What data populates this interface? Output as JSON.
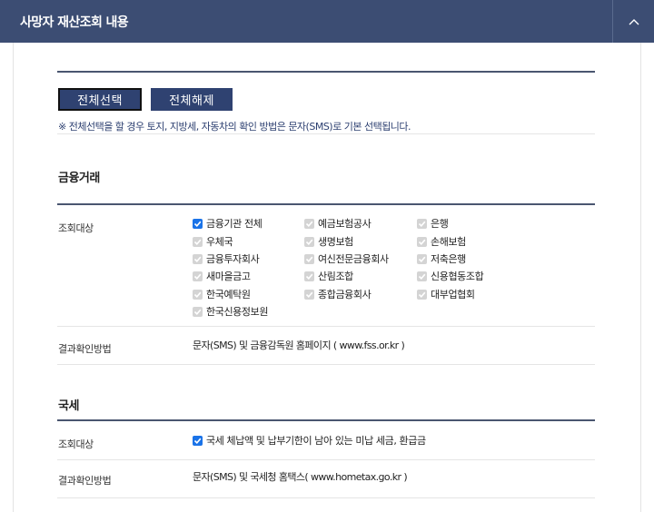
{
  "header": {
    "title": "사망자 재산조회 내용",
    "toggle_icon": "chevron-up-icon"
  },
  "buttons": {
    "select_all": "전체선택",
    "deselect_all": "전체해제"
  },
  "notice": "※ 전체선택을 할 경우 토지, 지방세, 자동차의 확인 방법은 문자(SMS)로 기본 선택됩니다.",
  "finance": {
    "title": "금융거래",
    "target_label": "조회대상",
    "items": [
      {
        "label": "금융기관 전체",
        "checked": true,
        "disabled": false
      },
      {
        "label": "예금보험공사",
        "checked": true,
        "disabled": true
      },
      {
        "label": "은행",
        "checked": true,
        "disabled": true
      },
      {
        "label": "우체국",
        "checked": true,
        "disabled": true
      },
      {
        "label": "생명보험",
        "checked": true,
        "disabled": true
      },
      {
        "label": "손해보험",
        "checked": true,
        "disabled": true
      },
      {
        "label": "금융투자회사",
        "checked": true,
        "disabled": true
      },
      {
        "label": "여신전문금융회사",
        "checked": true,
        "disabled": true
      },
      {
        "label": "저축은행",
        "checked": true,
        "disabled": true
      },
      {
        "label": "새마을금고",
        "checked": true,
        "disabled": true
      },
      {
        "label": "산림조합",
        "checked": true,
        "disabled": true
      },
      {
        "label": "신용협동조합",
        "checked": true,
        "disabled": true
      },
      {
        "label": "한국예탁원",
        "checked": true,
        "disabled": true
      },
      {
        "label": "종합금융회사",
        "checked": true,
        "disabled": true
      },
      {
        "label": "대부업협회",
        "checked": true,
        "disabled": true
      },
      {
        "label": "한국신용정보원",
        "checked": true,
        "disabled": true
      }
    ],
    "method_label": "결과확인방법",
    "method_value": "문자(SMS) 및 금융감독원 홈페이지 ( www.fss.or.kr )"
  },
  "tax": {
    "title": "국세",
    "target_label": "조회대상",
    "item": {
      "label": "국세 체납액 및 납부기한이 남아 있는 미납 세금, 환급금",
      "checked": true
    },
    "method_label": "결과확인방법",
    "method_value": "문자(SMS) 및 국세청 홈택스( www.hometax.go.kr )"
  }
}
